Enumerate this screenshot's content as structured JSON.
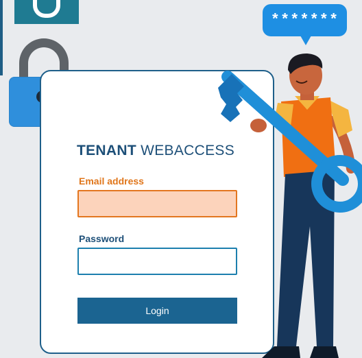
{
  "brand": {
    "strong": "TENANT",
    "light": "WEBACCESS"
  },
  "bubble": {
    "text": "*******"
  },
  "form": {
    "email_label": "Email address",
    "email_value": "",
    "password_label": "Password",
    "password_value": "",
    "login_label": "Login"
  },
  "colors": {
    "background": "#e9ebee",
    "brand_navy": "#1d4f78",
    "accent_orange": "#e0761b",
    "email_fill": "#fcd3bb",
    "button": "#1b6491",
    "bubble": "#1e8fe3",
    "lock": "#2f8fdc"
  },
  "icons": [
    "padlock-icon",
    "key-icon",
    "speech-bubble-icon"
  ]
}
